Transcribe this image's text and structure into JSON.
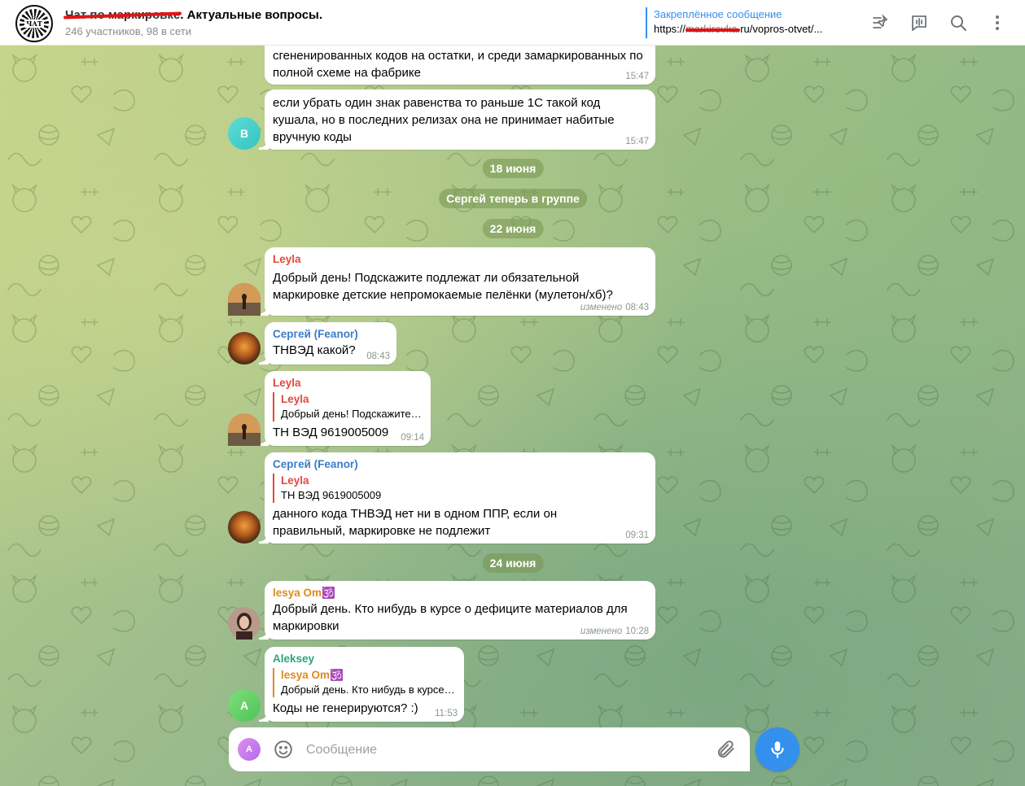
{
  "header": {
    "title_redacted": "Чат по маркировке",
    "title_rest": ". Актуальные вопросы.",
    "subtitle": "246 участников, 98 в сети",
    "logo_text": "ЧАТ",
    "pinned_label": "Закреплённое сообщение",
    "pinned_prefix": "https://",
    "pinned_redacted": "markirovka.",
    "pinned_suffix": "ru/vopros-otvet/...",
    "icons": [
      "pinned-list-icon",
      "live-stream-icon",
      "search-icon",
      "more-vertical-icon"
    ]
  },
  "messages": [
    {
      "text": "сгененированных кодов на остатки, и среди замаркированных по полной схеме на фабрике",
      "time": "15:47"
    },
    {
      "text": "если убрать один знак равенства то раньше 1С такой код кушала, но в последних релизах она не принимает набитые вручную коды",
      "time": "15:47",
      "avatar": "B"
    },
    {
      "date": "18 июня"
    },
    {
      "service": "Сергей теперь в группе"
    },
    {
      "date": "22 июня"
    },
    {
      "sender": "Leyla",
      "text": "Добрый день! Подскажите подлежат ли обязательной маркировке детские непромокаемые пелёнки (мулетон/хб)?",
      "edited": "изменено",
      "time": "08:43"
    },
    {
      "sender": "Сергей (Feanor)",
      "text": "ТНВЭД какой?",
      "time": "08:43"
    },
    {
      "sender": "Leyla",
      "reply_name": "Leyla",
      "reply_text": "Добрый день! Подскажите подлежат ли",
      "text": "ТН ВЭД 9619005009",
      "time": "09:14"
    },
    {
      "sender": "Сергей (Feanor)",
      "reply_name": "Leyla",
      "reply_text": "ТН ВЭД 9619005009",
      "text": "данного кода ТНВЭД нет ни в одном ППР, если он правильный, маркировке не подлежит",
      "time": "09:31"
    },
    {
      "date": "24 июня"
    },
    {
      "sender": "lesya Om🕉️",
      "text": "Добрый день. Кто нибудь в курсе о дефиците материалов для маркировки",
      "edited": "изменено",
      "time": "10:28"
    },
    {
      "sender": "Aleksey",
      "reply_name": "lesya Om🕉️",
      "reply_text": "Добрый день. Кто нибудь в курсе о дефиците",
      "text": "Коды не генерируются? :)",
      "time": "11:53",
      "avatar": "A"
    }
  ],
  "composer": {
    "avatar": "A",
    "placeholder": "Сообщение"
  },
  "colors": {
    "accent": "#3390ec",
    "leyla": "#e5473d",
    "sergey": "#3a7cc8",
    "lesya": "#e08a1e",
    "aleksey": "#2ba77a",
    "avatar_b": "#3ccdc6",
    "avatar_a": "#5ed060"
  }
}
